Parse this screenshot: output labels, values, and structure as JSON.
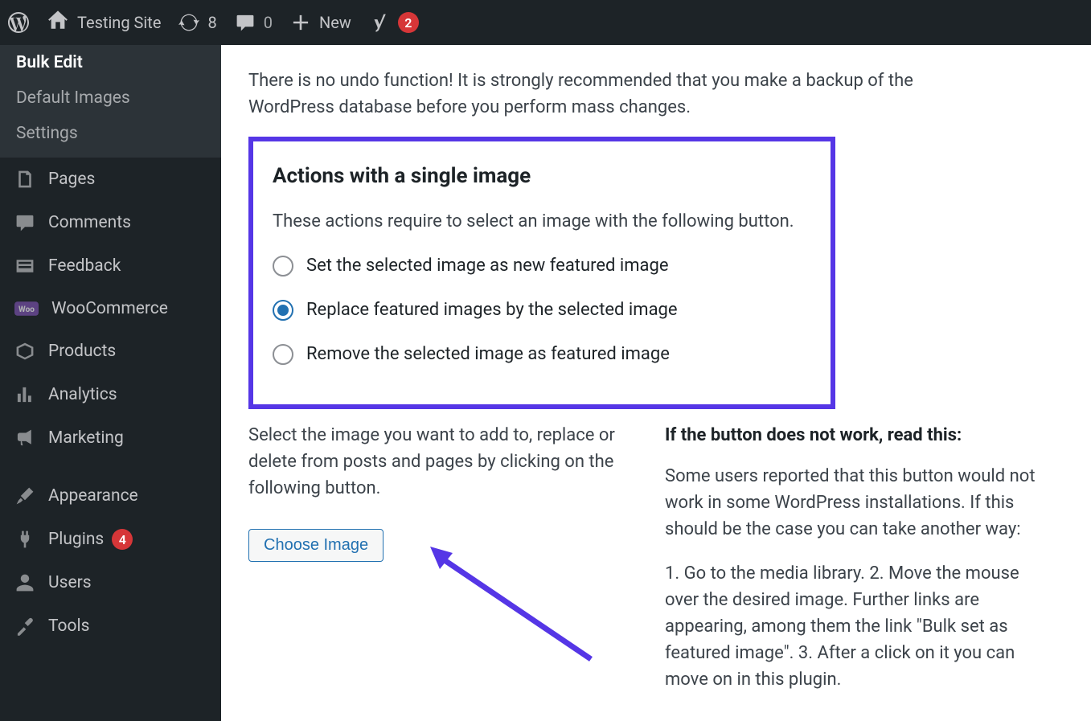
{
  "adminbar": {
    "site_name": "Testing Site",
    "updates_count": "8",
    "comments_count": "0",
    "new_label": "New",
    "yoast_badge": "2"
  },
  "sidebar": {
    "submenu": {
      "bulk_edit": "Bulk Edit",
      "default_images": "Default Images",
      "settings": "Settings"
    },
    "items": {
      "pages": "Pages",
      "comments": "Comments",
      "feedback": "Feedback",
      "woocommerce": "WooCommerce",
      "products": "Products",
      "analytics": "Analytics",
      "marketing": "Marketing",
      "appearance": "Appearance",
      "plugins": "Plugins",
      "plugins_count": "4",
      "users": "Users",
      "tools": "Tools"
    }
  },
  "content": {
    "warning": "There is no undo function! It is strongly recommended that you make a backup of the WordPress database before you perform mass changes.",
    "box": {
      "heading": "Actions with a single image",
      "desc": "These actions require to select an image with the following button.",
      "opt_set": "Set the selected image as new featured image",
      "opt_replace": "Replace featured images by the selected image",
      "opt_remove": "Remove the selected image as featured image"
    },
    "left_col": "Select the image you want to add to, replace or delete from posts and pages by clicking on the following button.",
    "choose_btn": "Choose Image",
    "right": {
      "heading": "If the button does not work, read this:",
      "p1": "Some users reported that this button would not work in some WordPress installations. If this should be the case you can take another way:",
      "p2": "1. Go to the media library. 2. Move the mouse over the desired image. Further links are appearing, among them the link \"Bulk set as featured image\". 3. After a click on it you can move on in this plugin."
    }
  }
}
